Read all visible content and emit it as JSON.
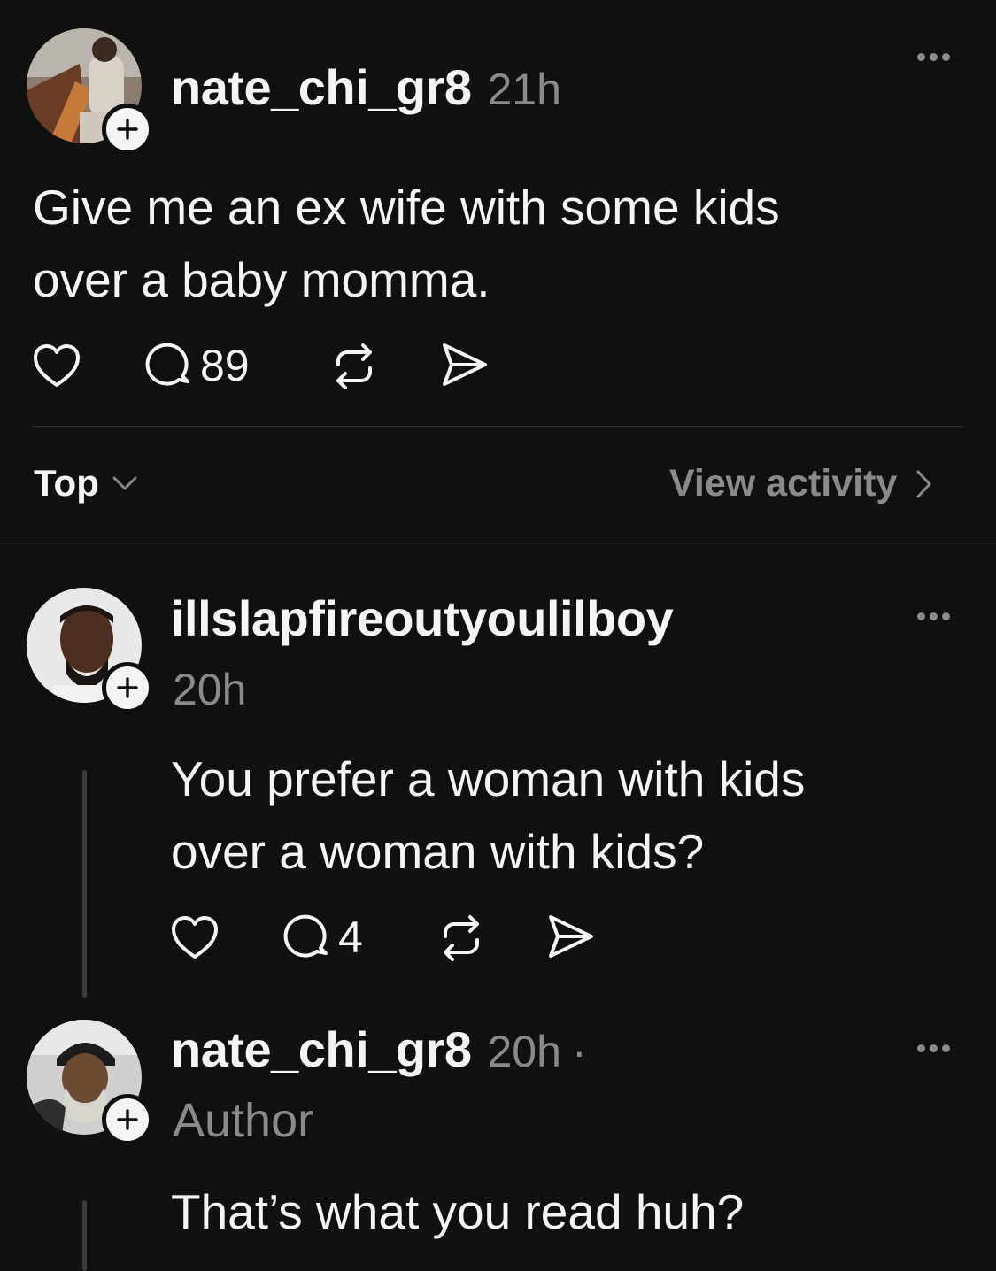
{
  "post": {
    "username": "nate_chi_gr8",
    "time": "21h",
    "text_line1": "Give me an ex wife with some kids",
    "text_line2": "over a baby momma.",
    "reply_count": "89"
  },
  "sort": {
    "label": "Top",
    "view_activity": "View activity"
  },
  "replies": [
    {
      "username": "illslapfireoutyoulilboy",
      "time": "20h",
      "text_line1": "You prefer a woman with kids",
      "text_line2": "over a woman with kids?",
      "reply_count": "4"
    },
    {
      "username": "nate_chi_gr8",
      "time": "20h",
      "separator": "·",
      "badge": "Author",
      "text_line1": "That’s what you read huh?"
    }
  ],
  "icons": {
    "like": "heart-icon",
    "reply": "comment-icon",
    "repost": "repost-icon",
    "share": "send-icon",
    "more": "more-icon",
    "follow": "plus-icon",
    "chevron_down": "chevron-down-icon",
    "chevron_right": "chevron-right-icon"
  },
  "colors": {
    "background": "#101010",
    "text_primary": "#f3f5f7",
    "text_secondary": "#8a8a8a",
    "divider": "#2d2d2d"
  }
}
